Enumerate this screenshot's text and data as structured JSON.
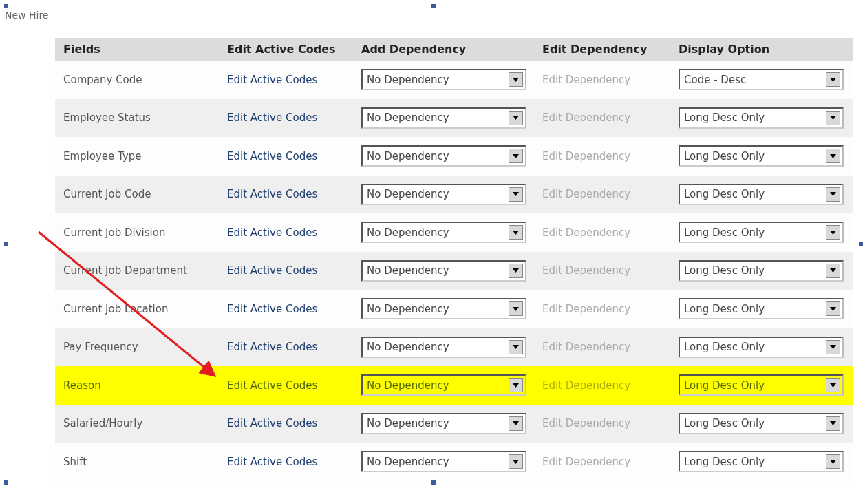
{
  "title": "New Hire",
  "columns": [
    "Fields",
    "Edit Active Codes",
    "Add Dependency",
    "Edit Dependency",
    "Display Option"
  ],
  "rows": [
    {
      "field": "Company Code",
      "edit_codes": "Edit Active Codes",
      "dependency": "No Dependency",
      "edit_dependency": "Edit Dependency",
      "display": "Code - Desc",
      "highlighted": false
    },
    {
      "field": "Employee Status",
      "edit_codes": "Edit Active Codes",
      "dependency": "No Dependency",
      "edit_dependency": "Edit Dependency",
      "display": "Long Desc Only",
      "highlighted": false
    },
    {
      "field": "Employee Type",
      "edit_codes": "Edit Active Codes",
      "dependency": "No Dependency",
      "edit_dependency": "Edit Dependency",
      "display": "Long Desc Only",
      "highlighted": false
    },
    {
      "field": "Current Job Code",
      "edit_codes": "Edit Active Codes",
      "dependency": "No Dependency",
      "edit_dependency": "Edit Dependency",
      "display": "Long Desc Only",
      "highlighted": false
    },
    {
      "field": "Current Job Division",
      "edit_codes": "Edit Active Codes",
      "dependency": "No Dependency",
      "edit_dependency": "Edit Dependency",
      "display": "Long Desc Only",
      "highlighted": false
    },
    {
      "field": "Current Job Department",
      "edit_codes": "Edit Active Codes",
      "dependency": "No Dependency",
      "edit_dependency": "Edit Dependency",
      "display": "Long Desc Only",
      "highlighted": false
    },
    {
      "field": "Current Job Location",
      "edit_codes": "Edit Active Codes",
      "dependency": "No Dependency",
      "edit_dependency": "Edit Dependency",
      "display": "Long Desc Only",
      "highlighted": false
    },
    {
      "field": "Pay Frequency",
      "edit_codes": "Edit Active Codes",
      "dependency": "No Dependency",
      "edit_dependency": "Edit Dependency",
      "display": "Long Desc Only",
      "highlighted": false
    },
    {
      "field": "Reason",
      "edit_codes": "Edit Active Codes",
      "dependency": "No Dependency",
      "edit_dependency": "Edit Dependency",
      "display": "Long Desc Only",
      "highlighted": true
    },
    {
      "field": "Salaried/Hourly",
      "edit_codes": "Edit Active Codes",
      "dependency": "No Dependency",
      "edit_dependency": "Edit Dependency",
      "display": "Long Desc Only",
      "highlighted": false
    },
    {
      "field": "Shift",
      "edit_codes": "Edit Active Codes",
      "dependency": "No Dependency",
      "edit_dependency": "Edit Dependency",
      "display": "Long Desc Only",
      "highlighted": false
    }
  ]
}
